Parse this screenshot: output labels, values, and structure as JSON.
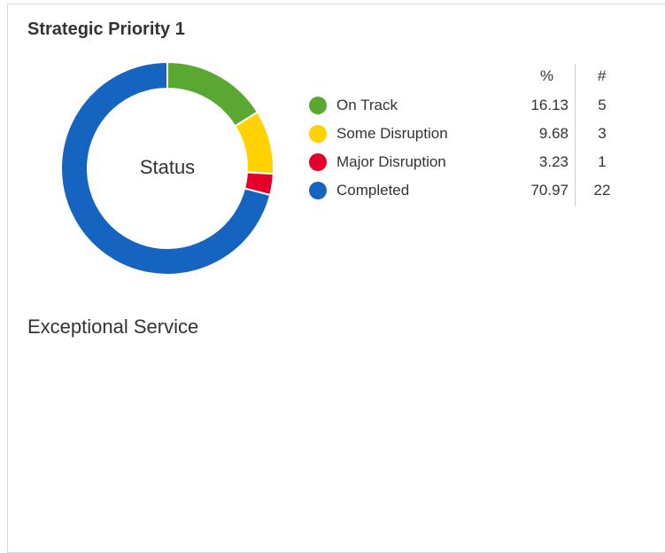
{
  "card": {
    "title": "Strategic Priority 1",
    "section_label": "Exceptional Service"
  },
  "legend": {
    "pct_header": "%",
    "count_header": "#",
    "items": [
      {
        "label": "On Track",
        "pct": "16.13",
        "count": "5",
        "color": "#5aa832"
      },
      {
        "label": "Some Disruption",
        "pct": "9.68",
        "count": "3",
        "color": "#ffd200"
      },
      {
        "label": "Major Disruption",
        "pct": "3.23",
        "count": "1",
        "color": "#e4002b"
      },
      {
        "label": "Completed",
        "pct": "70.97",
        "count": "22",
        "color": "#1565c0"
      }
    ]
  },
  "chart_data": {
    "type": "pie",
    "donut": true,
    "center_label": "Status",
    "categories": [
      "On Track",
      "Some Disruption",
      "Major Disruption",
      "Completed"
    ],
    "values": [
      5,
      3,
      1,
      22
    ],
    "percentages": [
      16.13,
      9.68,
      3.23,
      70.97
    ],
    "colors": [
      "#5aa832",
      "#ffd200",
      "#e4002b",
      "#1565c0"
    ],
    "legend_position": "right"
  }
}
